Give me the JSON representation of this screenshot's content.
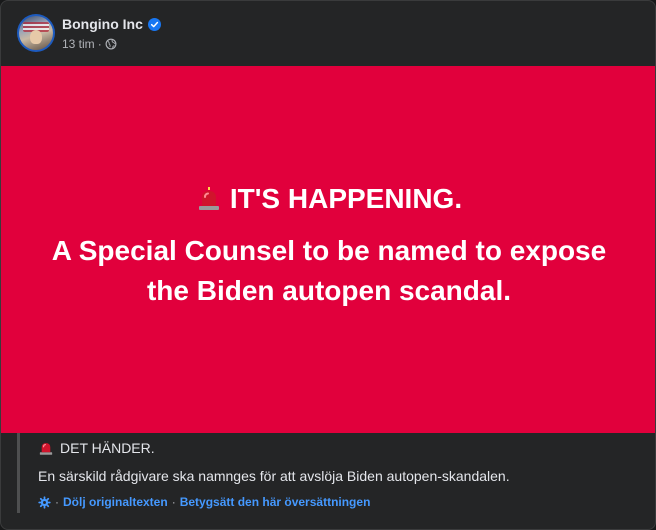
{
  "post": {
    "page_name": "Bongino Inc",
    "timestamp": "13 tim",
    "meta_separator": "·",
    "verified_icon": "verified-badge-icon",
    "audience_icon": "globe-icon"
  },
  "image": {
    "background_color": "#e1003c",
    "line1": "IT'S HAPPENING.",
    "line2": "A Special Counsel to be named to expose the Biden autopen scandal.",
    "emoji_icon": "siren-icon"
  },
  "translation": {
    "line1": "DET HÄNDER.",
    "line2": "En särskild rådgivare ska namnges för att avslöja Biden autopen-skandalen.",
    "separator": "·",
    "hide_original_label": "Dölj originaltexten",
    "rate_translation_label": "Betygsätt den här översättningen",
    "link_color": "#4599ff"
  }
}
